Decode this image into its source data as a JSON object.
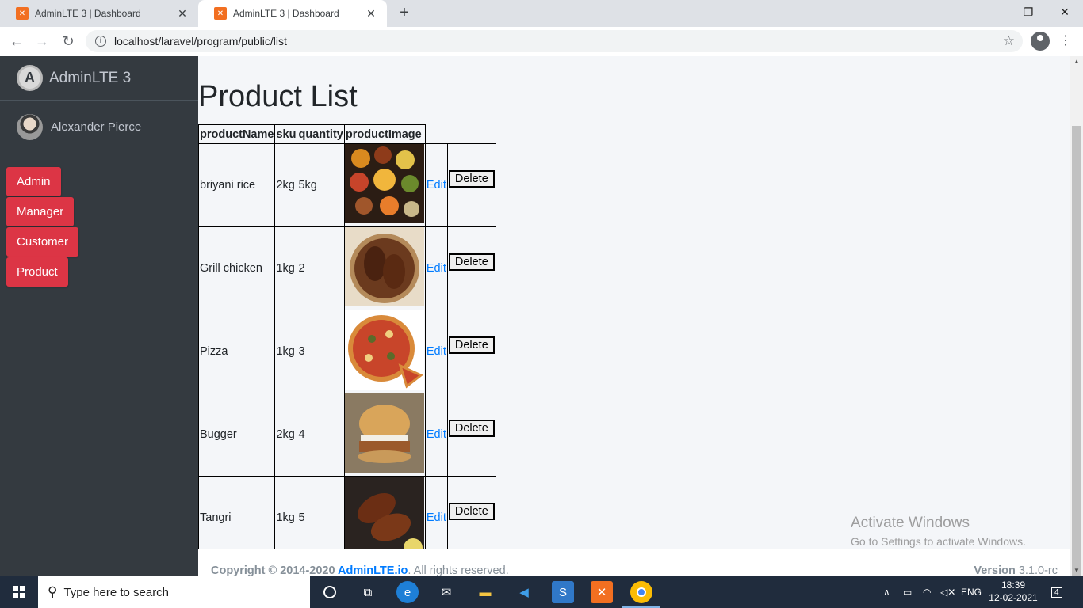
{
  "browser": {
    "tabs": [
      {
        "title": "AdminLTE 3 | Dashboard",
        "close": "✕"
      },
      {
        "title": "AdminLTE 3 | Dashboard",
        "close": "✕"
      }
    ],
    "new_tab": "+",
    "url": "localhost/laravel/program/public/list",
    "window_controls": [
      "—",
      "❐",
      "✕"
    ]
  },
  "sidebar": {
    "brand": "AdminLTE 3",
    "user": "Alexander Pierce",
    "menu": [
      {
        "label": "Admin"
      },
      {
        "label": "Manager"
      },
      {
        "label": "Customer"
      },
      {
        "label": "Product"
      }
    ]
  },
  "main": {
    "title": "Product List",
    "columns": [
      "productName",
      "sku",
      "quantity",
      "productImage"
    ],
    "rows": [
      {
        "name": "briyani rice",
        "sku": "2kg",
        "quantity": "5kg",
        "image": "spices-photo",
        "edit": "Edit",
        "delete": "Delete"
      },
      {
        "name": "Grill chicken",
        "sku": "1kg",
        "quantity": "2",
        "image": "grilled-chicken-photo",
        "edit": "Edit",
        "delete": "Delete"
      },
      {
        "name": "Pizza",
        "sku": "1kg",
        "quantity": "3",
        "image": "pizza-photo",
        "edit": "Edit",
        "delete": "Delete"
      },
      {
        "name": "Bugger",
        "sku": "2kg",
        "quantity": "4",
        "image": "burger-photo",
        "edit": "Edit",
        "delete": "Delete"
      },
      {
        "name": "Tangri",
        "sku": "1kg",
        "quantity": "5",
        "image": "tangri-photo",
        "edit": "Edit",
        "delete": "Delete"
      }
    ]
  },
  "footer": {
    "copyright_prefix": "Copyright © 2014-2020 ",
    "copyright_link": "AdminLTE.io",
    "copyright_suffix": ". All rights reserved.",
    "version_label": "Version",
    "version_value": " 3.1.0-rc"
  },
  "watermark": {
    "line1": "Activate Windows",
    "line2": "Go to Settings to activate Windows."
  },
  "taskbar": {
    "search_placeholder": "Type here to search",
    "language": "ENG",
    "time": "18:39",
    "date": "12-02-2021",
    "notification_count": "4"
  }
}
